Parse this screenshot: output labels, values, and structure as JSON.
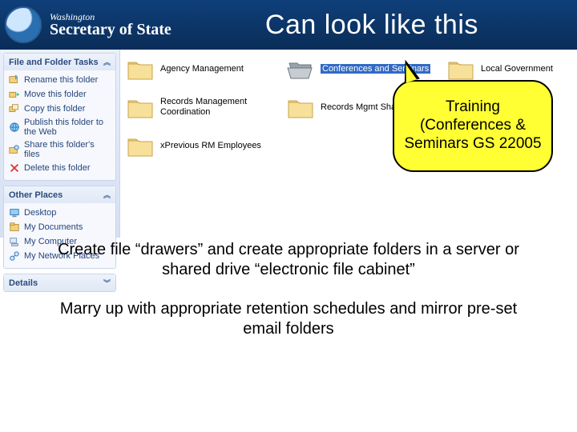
{
  "brand": {
    "state": "Washington",
    "sos": "Secretary of State"
  },
  "title": "Can look like this",
  "taskpane": {
    "boxes": [
      {
        "title": "File and Folder Tasks",
        "items": [
          {
            "icon": "rename-icon",
            "label": "Rename this folder"
          },
          {
            "icon": "move-icon",
            "label": "Move this folder"
          },
          {
            "icon": "copy-icon",
            "label": "Copy this folder"
          },
          {
            "icon": "publish-icon",
            "label": "Publish this folder to the Web"
          },
          {
            "icon": "share-icon",
            "label": "Share this folder's files"
          },
          {
            "icon": "delete-icon",
            "label": "Delete this folder"
          }
        ]
      },
      {
        "title": "Other Places",
        "items": [
          {
            "icon": "desktop-icon",
            "label": "Desktop"
          },
          {
            "icon": "mydocs-icon",
            "label": "My Documents"
          },
          {
            "icon": "computer-icon",
            "label": "My Computer"
          },
          {
            "icon": "network-icon",
            "label": "My Network Places"
          }
        ]
      },
      {
        "title": "Details",
        "items": []
      }
    ]
  },
  "folders": {
    "r1c1": {
      "label": "Agency Management",
      "selected": false,
      "open": false
    },
    "r1c2": {
      "label": "Conferences and Seminars",
      "selected": true,
      "open": true
    },
    "r1c3": {
      "label": "Local Government",
      "selected": false,
      "open": false
    },
    "r2c1": {
      "label": "Records Management Coordination",
      "selected": false,
      "open": false
    },
    "r2c2": {
      "label": "Records Mgmt Shared Files",
      "selected": false,
      "open": false
    },
    "r3c1": {
      "label": "xPrevious RM Employees",
      "selected": false,
      "open": false
    }
  },
  "callout": "Training (Conferences & Seminars GS 22005",
  "body": {
    "p1": "Create file “drawers” and create appropriate folders in a server or shared drive “electronic file cabinet”",
    "p2": "Marry up with appropriate retention schedules and mirror pre-set email folders"
  }
}
